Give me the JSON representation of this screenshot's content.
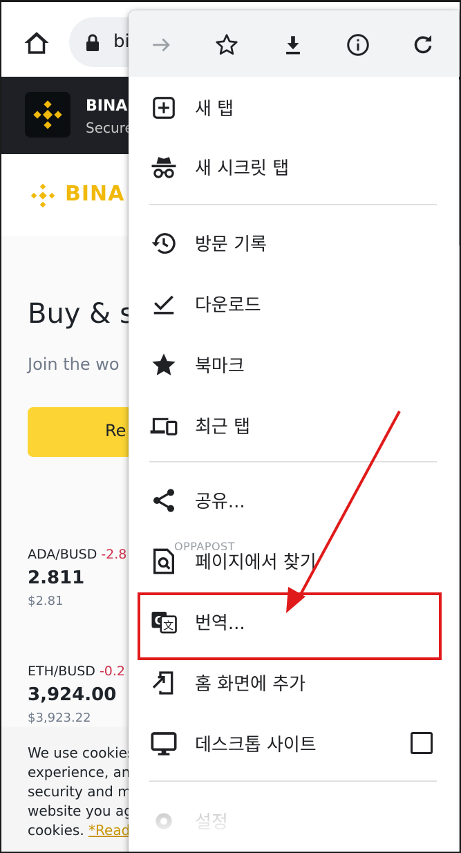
{
  "browser": {
    "url_partial": "bi",
    "home_icon": "home-icon",
    "lock_icon": "lock-icon"
  },
  "site": {
    "banner_name": "BINA",
    "banner_sub": "Secure",
    "brand_text": "BINA",
    "hero_title": "Buy & s",
    "hero_subtitle": "Join the wo",
    "hero_button": "Re",
    "tickers": [
      {
        "pair": "ADA/BUSD",
        "change": "-2.8",
        "price": "2.811",
        "usd": "$2.81"
      },
      {
        "pair": "ETH/BUSD",
        "change": "-0.2",
        "price": "3,924.00",
        "usd": "$3,923.22"
      }
    ],
    "cookie_lines": [
      "We use cookies",
      "experience, ana",
      "security and ma",
      "website you ag"
    ],
    "cookie_tail": "cookies. ",
    "cookie_link": "*Read more about cookies*"
  },
  "menu": {
    "toolbar_icons": [
      "forward-icon",
      "star-outline-icon",
      "download-icon",
      "info-icon",
      "refresh-icon"
    ],
    "items": [
      {
        "label": "새 탭",
        "icon": "new-tab-icon"
      },
      {
        "label": "새 시크릿 탭",
        "icon": "incognito-icon"
      },
      {
        "label": "방문 기록",
        "icon": "history-icon"
      },
      {
        "label": "다운로드",
        "icon": "downloads-icon"
      },
      {
        "label": "북마크",
        "icon": "bookmark-star-icon"
      },
      {
        "label": "최근 탭",
        "icon": "recent-tabs-icon"
      },
      {
        "label": "공유...",
        "icon": "share-icon"
      },
      {
        "label": "페이지에서 찾기",
        "icon": "find-in-page-icon"
      },
      {
        "label": "번역...",
        "icon": "translate-icon"
      },
      {
        "label": "홈 화면에 추가",
        "icon": "add-to-home-icon"
      },
      {
        "label": "데스크톱 사이트",
        "icon": "desktop-icon",
        "checked": false
      },
      {
        "label": "설정",
        "icon": "settings-icon"
      }
    ]
  },
  "watermark": "OPPAPOST",
  "annotation": {
    "color": "#e01a1a"
  },
  "colors": {
    "brand_yellow": "#f0b90b",
    "button_yellow": "#fcd535",
    "negative_red": "#cf304a"
  }
}
